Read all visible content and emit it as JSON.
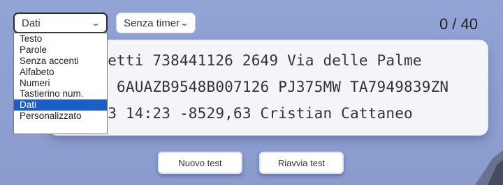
{
  "mode_select": {
    "value": "Dati",
    "options": [
      "Testo",
      "Parole",
      "Senza accenti",
      "Alfabeto",
      "Numeri",
      "Tastierino num.",
      "Dati",
      "Personalizzato"
    ],
    "selected_index": 6
  },
  "timer_select": {
    "value": "Senza timer"
  },
  "counter": "0 / 40",
  "typing_text": {
    "line1": "Benedetti 738441126 2649 Via delle Palme",
    "line2": "30424 6AUAZB9548B007126 PJ375MW TA7949839ZN",
    "line3": "1/1993 14:23 -8529,63 Cristian Cattaneo"
  },
  "buttons": {
    "new_test": "Nuovo test",
    "restart_test": "Riavvia test"
  },
  "icons": {
    "chevron": "chevron-down-icon"
  }
}
